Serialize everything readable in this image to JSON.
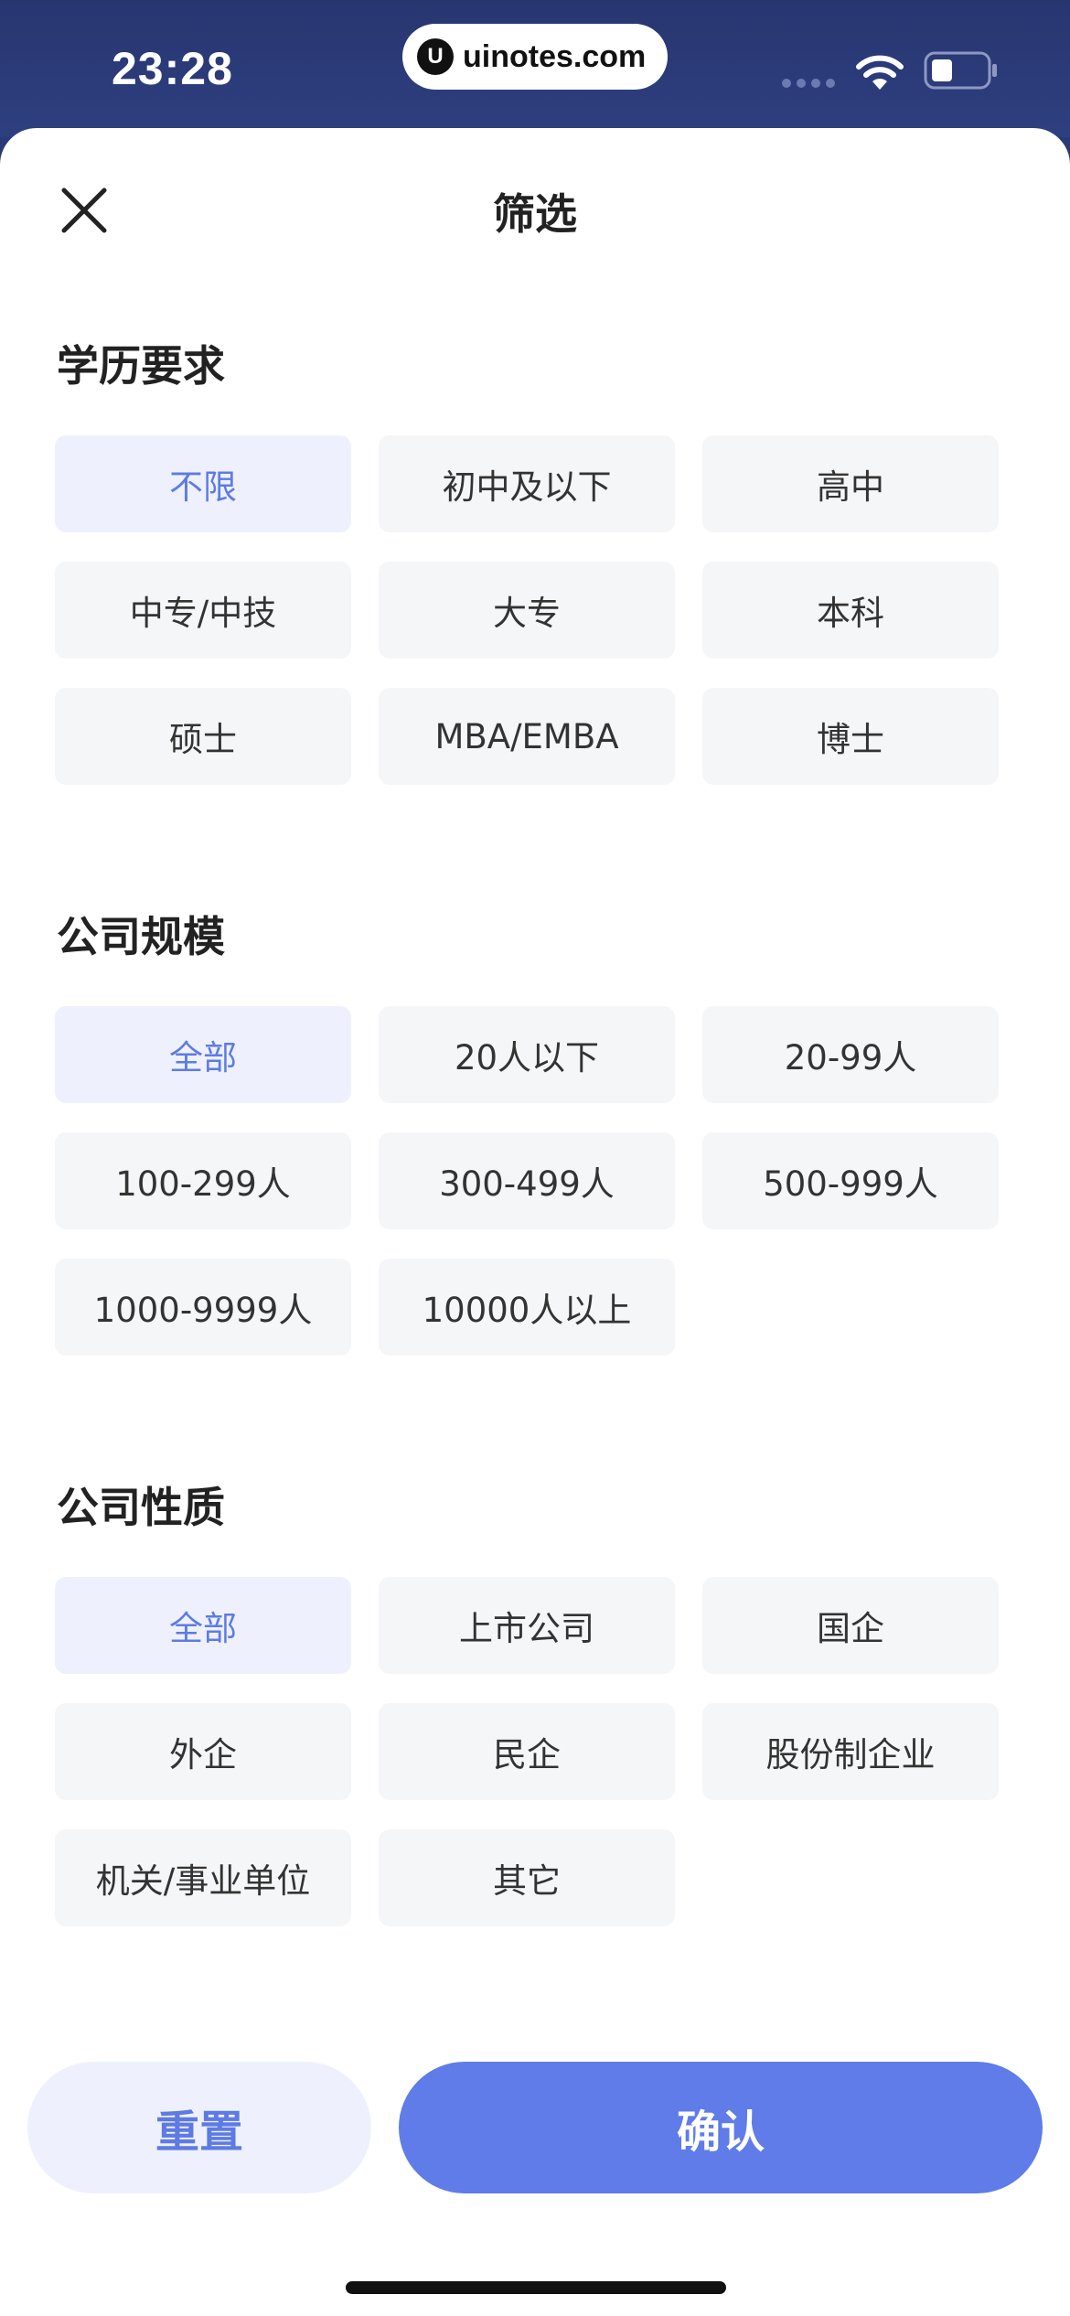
{
  "status_bar": {
    "time": "23:28",
    "url": "uinotes.com",
    "logo_letter": "U"
  },
  "sheet": {
    "title": "筛选"
  },
  "sections": [
    {
      "title": "学历要求",
      "options": [
        {
          "label": "不限",
          "selected": true
        },
        {
          "label": "初中及以下",
          "selected": false
        },
        {
          "label": "高中",
          "selected": false
        },
        {
          "label": "中专/中技",
          "selected": false
        },
        {
          "label": "大专",
          "selected": false
        },
        {
          "label": "本科",
          "selected": false
        },
        {
          "label": "硕士",
          "selected": false
        },
        {
          "label": "MBA/EMBA",
          "selected": false
        },
        {
          "label": "博士",
          "selected": false
        }
      ]
    },
    {
      "title": "公司规模",
      "options": [
        {
          "label": "全部",
          "selected": true
        },
        {
          "label": "20人以下",
          "selected": false
        },
        {
          "label": "20-99人",
          "selected": false
        },
        {
          "label": "100-299人",
          "selected": false
        },
        {
          "label": "300-499人",
          "selected": false
        },
        {
          "label": "500-999人",
          "selected": false
        },
        {
          "label": "1000-9999人",
          "selected": false
        },
        {
          "label": "10000人以上",
          "selected": false
        }
      ]
    },
    {
      "title": "公司性质",
      "options": [
        {
          "label": "全部",
          "selected": true
        },
        {
          "label": "上市公司",
          "selected": false
        },
        {
          "label": "国企",
          "selected": false
        },
        {
          "label": "外企",
          "selected": false
        },
        {
          "label": "民企",
          "selected": false
        },
        {
          "label": "股份制企业",
          "selected": false
        },
        {
          "label": "机关/事业单位",
          "selected": false
        },
        {
          "label": "其它",
          "selected": false
        }
      ]
    }
  ],
  "footer": {
    "reset_label": "重置",
    "confirm_label": "确认"
  },
  "colors": {
    "accent": "#5f7ce8",
    "accent_light": "#eef1fd",
    "chip_bg": "#f5f6f7",
    "status_bar_bg": "#2a3a78"
  },
  "icons": {
    "close": "close-icon",
    "wifi": "wifi-icon",
    "battery": "battery-icon"
  }
}
